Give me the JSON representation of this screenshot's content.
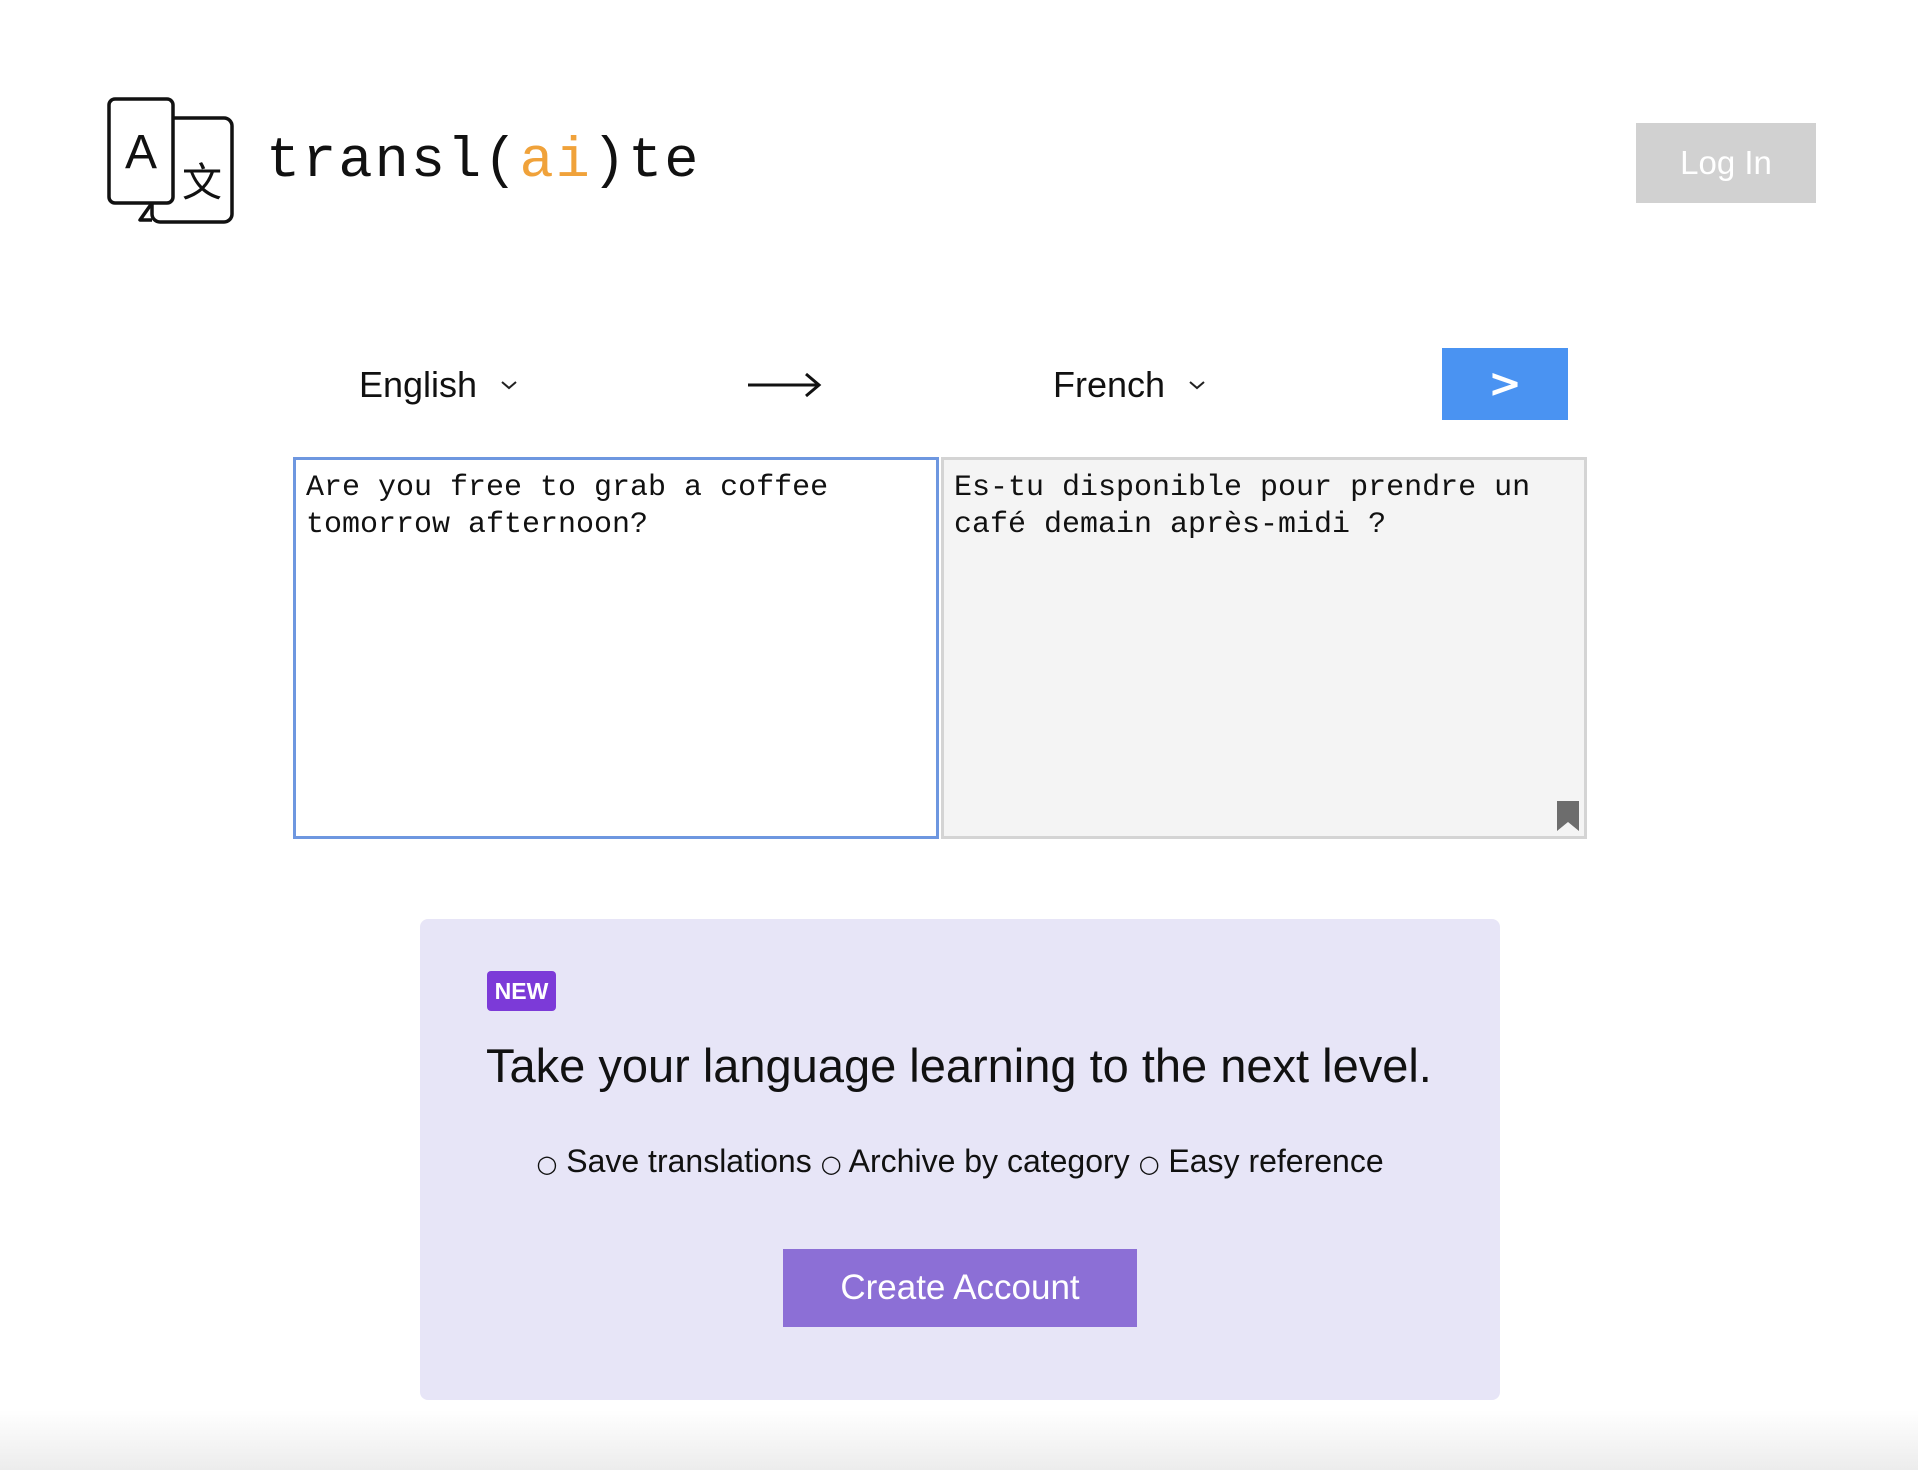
{
  "header": {
    "brand_prefix": "transl(",
    "brand_ai": "ai",
    "brand_suffix": ")te",
    "logo_glyph_latin": "A",
    "logo_glyph_cjk": "文",
    "login_label": "Log In"
  },
  "translator": {
    "source_language": "English",
    "target_language": "French",
    "translate_button_label": ">",
    "source_text": "Are you free to grab a coffee tomorrow afternoon?",
    "output_text": "Es-tu disponible pour prendre un café demain après-midi ?",
    "arrow_icon": "arrow-right-icon",
    "bookmark_icon": "bookmark-icon"
  },
  "promo": {
    "badge": "NEW",
    "title": "Take your language learning to the next level.",
    "bullet": "○",
    "features": [
      "Save translations",
      "Archive by category",
      "Easy reference"
    ],
    "cta_label": "Create Account"
  },
  "colors": {
    "brand_accent": "#f0a23a",
    "translate_button": "#4a93f2",
    "login_button": "#d1d1d1",
    "promo_background": "#e7e5f7",
    "badge": "#7c3ad8",
    "cta_button": "#8c6fd6",
    "source_border": "#6e97e0"
  }
}
